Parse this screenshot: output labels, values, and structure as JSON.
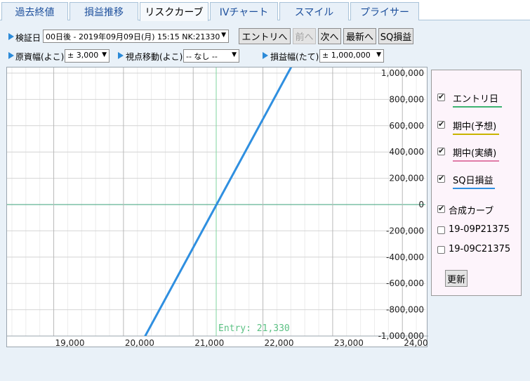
{
  "tabs": [
    {
      "label": "過去終値",
      "active": false
    },
    {
      "label": "損益推移",
      "active": false
    },
    {
      "label": "リスクカーブ",
      "active": true
    },
    {
      "label": "IVチャート",
      "active": false
    },
    {
      "label": "スマイル",
      "active": false
    },
    {
      "label": "プライサー",
      "active": false
    }
  ],
  "controls": {
    "verify_date_label": "検証日",
    "verify_date_value": "00日後 - 2019年09月09日(月) 15:15 NK:21330",
    "entry_button": "エントリへ",
    "prev_button": "前へ",
    "next_button": "次へ",
    "latest_button": "最新へ",
    "sq_button": "SQ損益",
    "underlying_width_label": "原資幅(よこ)",
    "underlying_width_value": "± 3,000",
    "viewpoint_label": "視点移動(よこ)",
    "viewpoint_value": "-- なし --",
    "pnl_width_label": "損益幅(たて)",
    "pnl_width_value": "± 1,000,000"
  },
  "legend": {
    "items": [
      {
        "label": "エントリ日",
        "checked": true,
        "color": "#3cb371"
      },
      {
        "label": "期中(予想)",
        "checked": true,
        "color": "#c8b400"
      },
      {
        "label": "期中(実績)",
        "checked": true,
        "color": "#e07ca8"
      },
      {
        "label": "SQ日損益",
        "checked": true,
        "color": "#2f8fe0"
      },
      {
        "label": "合成カーブ",
        "checked": true,
        "color": ""
      },
      {
        "label": "19-09P21375",
        "checked": false,
        "color": ""
      },
      {
        "label": "19-09C21375",
        "checked": false,
        "color": ""
      }
    ],
    "update_button": "更新"
  },
  "chart_data": {
    "type": "line",
    "xlim": [
      18330,
      24330
    ],
    "ylim": [
      -1000000,
      1000000
    ],
    "x_ticks": [
      19000,
      20000,
      21000,
      22000,
      23000,
      24000
    ],
    "x_tick_labels": [
      "19,000",
      "20,000",
      "21,000",
      "22,000",
      "23,000",
      "24,00"
    ],
    "y_ticks": [
      1000000,
      800000,
      600000,
      400000,
      200000,
      0,
      -200000,
      -400000,
      -600000,
      -800000,
      -1000000
    ],
    "y_tick_labels": [
      "1,000,000",
      "800,000",
      "600,000",
      "400,000",
      "200,000",
      "0",
      "-200,000",
      "-400,000",
      "-600,000",
      "-800,000",
      "-1,000,000"
    ],
    "entry_x": 21330,
    "entry_label": "Entry: 21,330",
    "series": [
      {
        "color": "#2f8fe0",
        "x": [
          20240,
          22440
        ],
        "y": [
          -1070000,
          1080000
        ]
      }
    ]
  }
}
